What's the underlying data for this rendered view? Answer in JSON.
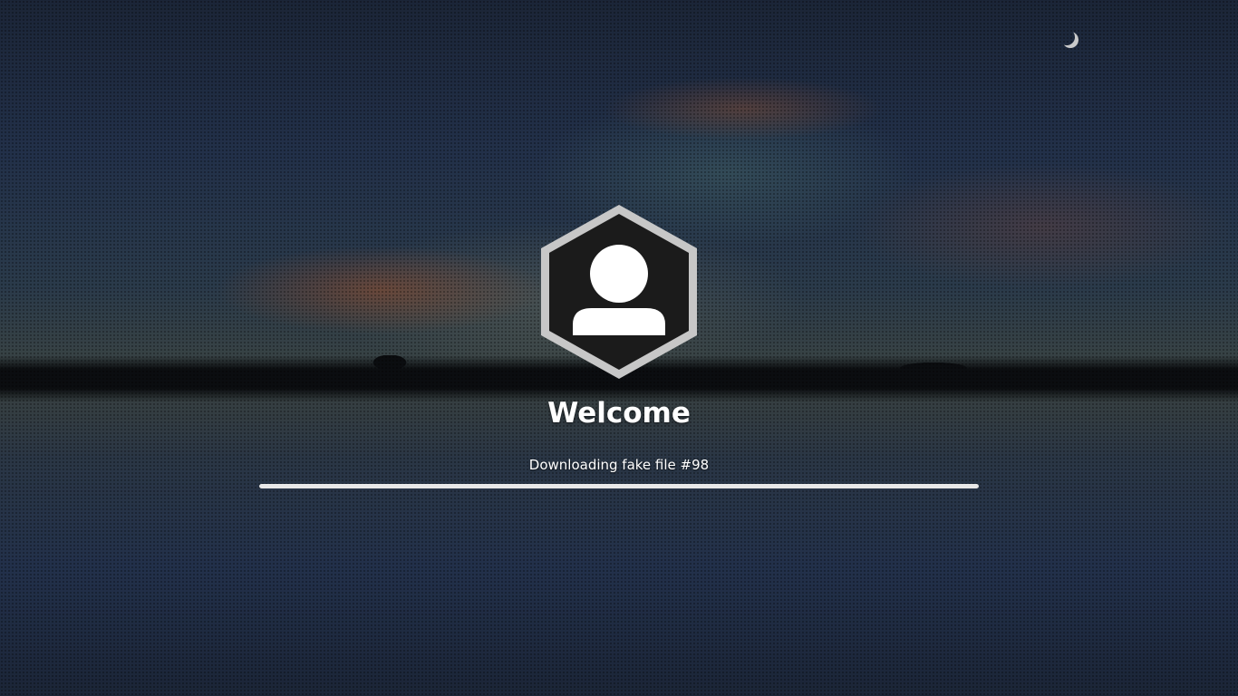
{
  "login": {
    "welcome_text": "Welcome",
    "status_text": "Downloading fake file #98",
    "avatar_icon": "user-avatar-icon"
  },
  "progress": {
    "fraction": 1.0
  },
  "colors": {
    "text": "#ffffff",
    "progress_fill": "#e8e8e8",
    "avatar_ring": "#c7c7c7",
    "avatar_inner": "#1b1b1b",
    "avatar_person": "#ffffff"
  },
  "background": {
    "scene": "dusk lake reflection with treeline",
    "decoration": "crescent-moon-icon"
  }
}
